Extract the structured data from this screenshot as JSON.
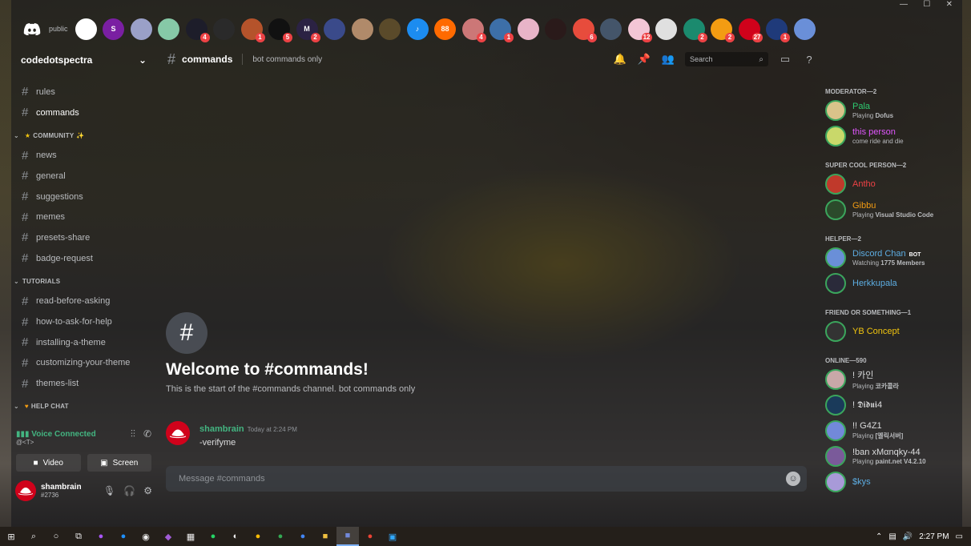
{
  "window": {
    "minimize": "—",
    "maximize": "☐",
    "close": "✕"
  },
  "serverbar": {
    "public_label": "public",
    "servers": [
      {
        "name": "server-1",
        "color": "#ffffff",
        "label": "",
        "badge": ""
      },
      {
        "name": "server-2",
        "color": "#7a1fa2",
        "label": "S",
        "badge": ""
      },
      {
        "name": "server-3",
        "color": "#9aa0c8",
        "label": "",
        "badge": ""
      },
      {
        "name": "server-4",
        "color": "#86c9a7",
        "label": "",
        "badge": ""
      },
      {
        "name": "server-5",
        "color": "#1d1d2a",
        "label": "",
        "badge": "4"
      },
      {
        "name": "server-6",
        "color": "#2a2a2a",
        "label": "",
        "badge": ""
      },
      {
        "name": "server-7",
        "color": "#b5532b",
        "label": "",
        "badge": "1"
      },
      {
        "name": "server-8",
        "color": "#111111",
        "label": "",
        "badge": "5"
      },
      {
        "name": "server-9",
        "color": "#2b2243",
        "label": "M",
        "badge": "2"
      },
      {
        "name": "server-10",
        "color": "#3a4a8a",
        "label": "",
        "badge": ""
      },
      {
        "name": "server-11",
        "color": "#b08a6a",
        "label": "",
        "badge": ""
      },
      {
        "name": "server-12",
        "color": "#5a4a2a",
        "label": "",
        "badge": ""
      },
      {
        "name": "server-13",
        "color": "#1c8cf0",
        "label": "♪",
        "badge": ""
      },
      {
        "name": "server-14",
        "color": "#ff6a00",
        "label": "88",
        "badge": ""
      },
      {
        "name": "server-15",
        "color": "#c77",
        "label": "",
        "badge": "4"
      },
      {
        "name": "server-16",
        "color": "#3d6fa8",
        "label": "",
        "badge": "1"
      },
      {
        "name": "server-17",
        "color": "#e8b4c8",
        "label": "",
        "badge": ""
      },
      {
        "name": "server-18",
        "color": "#2a1a1a",
        "label": "",
        "badge": ""
      },
      {
        "name": "server-19",
        "color": "#e74c3c",
        "label": "",
        "badge": "6"
      },
      {
        "name": "server-20",
        "color": "#44556a",
        "label": "",
        "badge": ""
      },
      {
        "name": "server-21",
        "color": "#f3c6d6",
        "label": "",
        "badge": "12"
      },
      {
        "name": "server-22",
        "color": "#e0e0e0",
        "label": "",
        "badge": ""
      },
      {
        "name": "server-23",
        "color": "#1b8a6e",
        "label": "",
        "badge": "2"
      },
      {
        "name": "server-24",
        "color": "#f39c12",
        "label": "",
        "badge": "2"
      },
      {
        "name": "server-25",
        "color": "#d0021b",
        "label": "",
        "badge": "27"
      },
      {
        "name": "server-26",
        "color": "#1f3a7a",
        "label": "",
        "badge": "1"
      },
      {
        "name": "server-27",
        "color": "#6a8fd8",
        "label": "",
        "badge": ""
      }
    ]
  },
  "sidebar": {
    "guild_name": "codedotspectra",
    "top_channels": [
      "rules",
      "commands"
    ],
    "categories": [
      {
        "name": "COMMUNITY",
        "channels": [
          "news",
          "general",
          "suggestions",
          "memes",
          "presets-share",
          "badge-request"
        ]
      },
      {
        "name": "TUTORIALS",
        "channels": [
          "read-before-asking",
          "how-to-ask-for-help",
          "installing-a-theme",
          "customizing-your-theme",
          "themes-list"
        ]
      },
      {
        "name": "HELP CHAT",
        "channels": []
      }
    ],
    "voice": {
      "status": "Voice Connected",
      "server": "@<T>",
      "video": "Video",
      "screen": "Screen"
    },
    "user": {
      "name": "shambrain",
      "tag": "#2736"
    }
  },
  "chat": {
    "channel": "commands",
    "topic": "bot commands only",
    "search_placeholder": "Search",
    "welcome_title": "Welcome to #commands!",
    "welcome_text": "This is the start of the #commands channel. bot commands only",
    "message": {
      "author": "shambrain",
      "time": "Today at 2:24 PM",
      "text": "-verifyme"
    },
    "composer_placeholder": "Message #commands"
  },
  "members": {
    "groups": [
      {
        "title": "MODERATOR—2",
        "members": [
          {
            "name": "Pala",
            "color": "#2ecc71",
            "activity": "Playing ",
            "detail": "Dofus",
            "avatar": "#d9c38a"
          },
          {
            "name": "this person",
            "color": "#e056fd",
            "activity": "come ride and die",
            "detail": "",
            "avatar": "#c9d86a"
          }
        ]
      },
      {
        "title": "SUPER COOL PERSON—2",
        "members": [
          {
            "name": "Antho",
            "color": "#ed4245",
            "activity": "",
            "detail": "",
            "avatar": "#c0392b"
          },
          {
            "name": "Gibbu",
            "color": "#f39c12",
            "activity": "Playing ",
            "detail": "Visual Studio Code",
            "avatar": "#2b4a2b"
          }
        ]
      },
      {
        "title": "HELPER—2",
        "members": [
          {
            "name": "Discord Chan",
            "color": "#5dade2",
            "activity": "Watching ",
            "detail": "1775 Members",
            "avatar": "#6a8fd8",
            "bot": "BOT"
          },
          {
            "name": "Herkkupala",
            "color": "#5dade2",
            "activity": "",
            "detail": "",
            "avatar": "#2a2a3a"
          }
        ]
      },
      {
        "title": "FRIEND OR SOMETHING—1",
        "members": [
          {
            "name": "YB Concept",
            "color": "#f1c40f",
            "activity": "",
            "detail": "",
            "avatar": "#333333"
          }
        ]
      },
      {
        "title": "ONLINE—590",
        "members": [
          {
            "name": "! 카인",
            "color": "#dcddde",
            "activity": "Playing ",
            "detail": "코카콜라",
            "avatar": "#c8a8a8"
          },
          {
            "name": "! 𝕯𝖎𝖉𝖚𝖎4",
            "color": "#dcddde",
            "activity": "",
            "detail": "",
            "avatar": "#1a3a5a"
          },
          {
            "name": "!! G4Z1",
            "color": "#dcddde",
            "activity": "Playing ",
            "detail": "[엘릭서버]",
            "avatar": "#7289da"
          },
          {
            "name": "!ban xMαnqky-44",
            "color": "#dcddde",
            "activity": "Playing ",
            "detail": "paint.net V4.2.10",
            "avatar": "#7a5a9a"
          },
          {
            "name": "$kys",
            "color": "#5dade2",
            "activity": "",
            "detail": "",
            "avatar": "#a89ad8"
          }
        ]
      }
    ]
  },
  "taskbar": {
    "time": "2:27 PM"
  }
}
